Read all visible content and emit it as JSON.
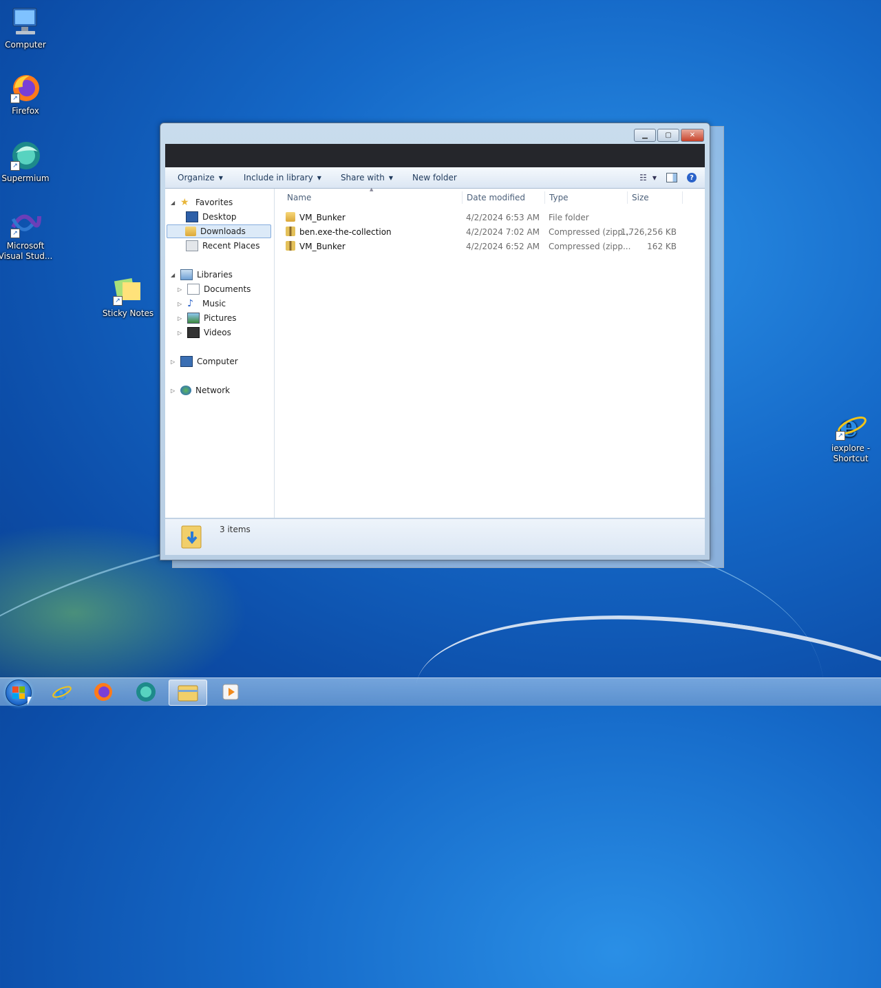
{
  "desktop": {
    "icons": [
      {
        "label": "Computer"
      },
      {
        "label": "Firefox"
      },
      {
        "label": "Supermium"
      },
      {
        "label": "Microsoft Visual Stud..."
      },
      {
        "label": "Sticky Notes"
      },
      {
        "label": "iexplore - Shortcut"
      }
    ]
  },
  "window": {
    "toolbar": {
      "organize": "Organize",
      "include_in_library": "Include in library",
      "share_with": "Share with",
      "new_folder": "New folder"
    },
    "nav": {
      "favorites": "Favorites",
      "desktop": "Desktop",
      "downloads": "Downloads",
      "recent_places": "Recent Places",
      "libraries": "Libraries",
      "documents": "Documents",
      "music": "Music",
      "pictures": "Pictures",
      "videos": "Videos",
      "computer": "Computer",
      "network": "Network"
    },
    "columns": {
      "name": "Name",
      "date_modified": "Date modified",
      "type": "Type",
      "size": "Size"
    },
    "files": [
      {
        "name": "VM_Bunker",
        "date": "4/2/2024 6:53 AM",
        "type": "File folder",
        "size": ""
      },
      {
        "name": "ben.exe-the-collection",
        "date": "4/2/2024 7:02 AM",
        "type": "Compressed (zipp...",
        "size": "1,726,256 KB"
      },
      {
        "name": "VM_Bunker",
        "date": "4/2/2024 6:52 AM",
        "type": "Compressed (zipp...",
        "size": "162 KB"
      }
    ],
    "status": {
      "count": "3 items"
    }
  },
  "colors": {
    "accent": "#2a62c9",
    "selection": "#dceaf8"
  }
}
